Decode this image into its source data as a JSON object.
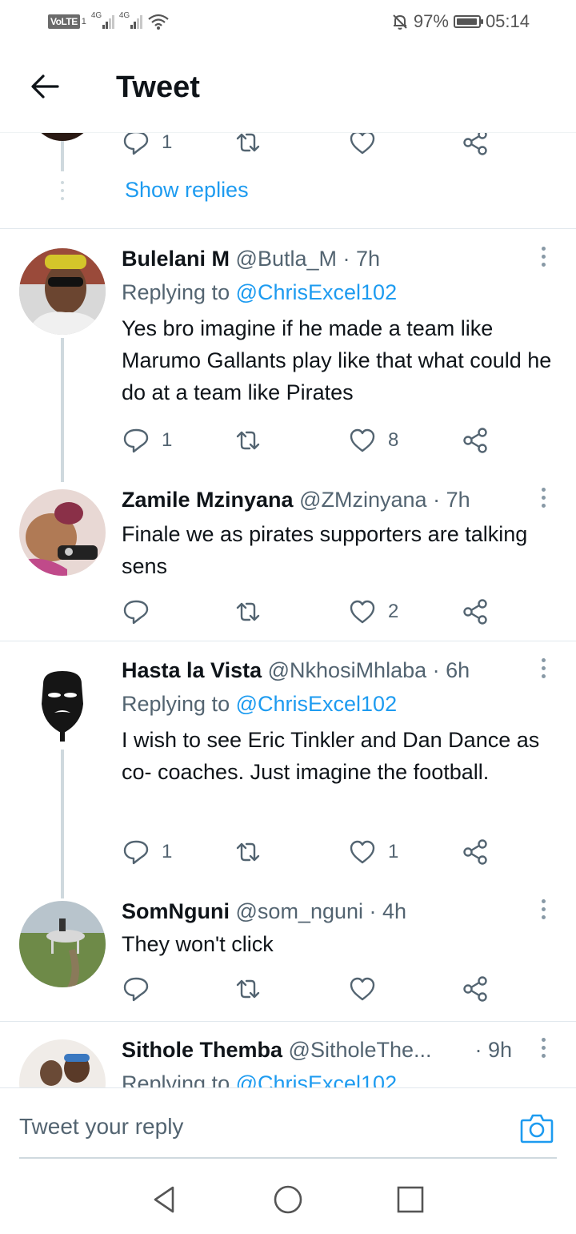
{
  "status_bar": {
    "volte": "VoLTE",
    "sim": "1",
    "net1": "4G",
    "net2": "4G",
    "battery_pct": "97%",
    "battery_level": 0.97,
    "time": "05:14",
    "icons": [
      "signal-icon",
      "wifi-icon",
      "mute-icon",
      "battery-icon"
    ]
  },
  "header": {
    "title": "Tweet",
    "back_icon": "back-arrow-icon"
  },
  "top_partial": {
    "reply_count": "1",
    "show_replies": "Show replies"
  },
  "tweets": [
    {
      "name": "Bulelani M",
      "handle": "@Butla_M",
      "time": "· 7h",
      "replying_prefix": "Replying to",
      "replying_to": "@ChrisExcel102",
      "text": "Yes bro imagine if he made a team like Marumo Gallants play like that what could he do at a team like Pirates",
      "replies": "1",
      "retweets": "",
      "likes": "8"
    },
    {
      "name": "Zamile Mzinyana",
      "handle": "@ZMzinyana",
      "time": "· 7h",
      "text": "Finale we as pirates supporters are talking sens",
      "replies": "",
      "retweets": "",
      "likes": "2"
    },
    {
      "name": "Hasta la Vista",
      "handle": "@NkhosiMhlaba",
      "time": "· 6h",
      "replying_prefix": "Replying to",
      "replying_to": "@ChrisExcel102",
      "text": "I wish to see Eric Tinkler and Dan Dance as co- coaches.  Just imagine the football.",
      "replies": "1",
      "retweets": "",
      "likes": "1"
    },
    {
      "name": "SomNguni",
      "handle": "@som_nguni",
      "time": "· 4h",
      "text": "They won't click",
      "replies": "",
      "retweets": "",
      "likes": ""
    },
    {
      "name": "Sithole Themba",
      "handle": "@SitholeThe...",
      "time": "· 9h",
      "replying_prefix": "Replying to",
      "replying_to": "@ChrisExcel102"
    }
  ],
  "reply_bar": {
    "placeholder": "Tweet your reply",
    "camera_icon": "camera-icon"
  },
  "navbar": {
    "icons": [
      "back-triangle-icon",
      "home-circle-icon",
      "recents-square-icon"
    ]
  },
  "colors": {
    "accent": "#1d9bf0",
    "text": "#0f1419",
    "secondary": "#536471",
    "thread": "#cfd9de"
  }
}
